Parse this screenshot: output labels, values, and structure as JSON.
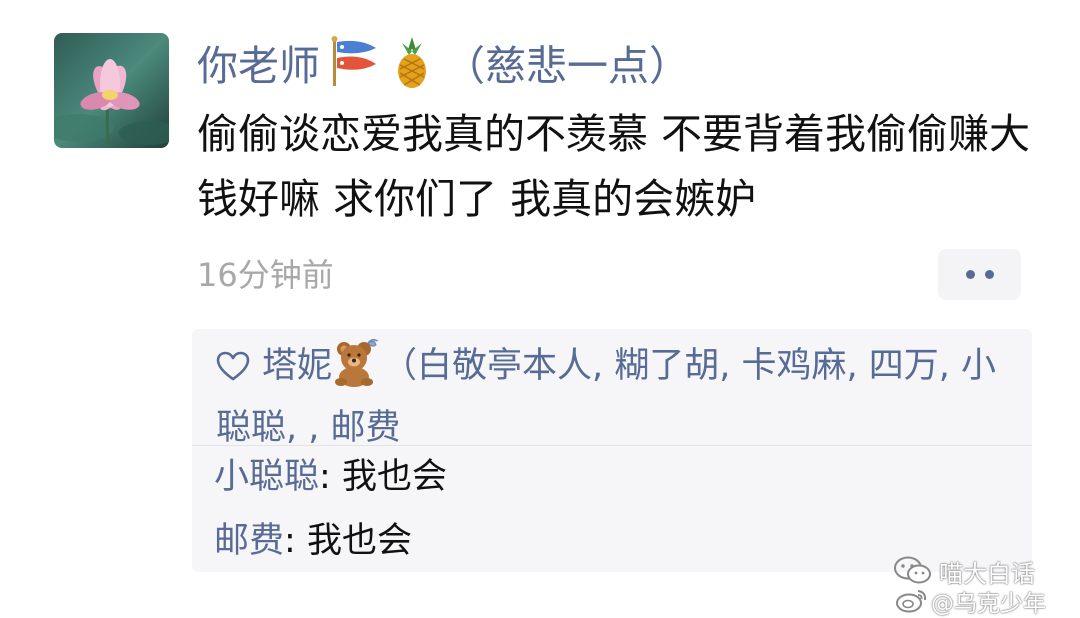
{
  "post": {
    "username": "你老师",
    "username_suffix": "（慈悲一点）",
    "name_emoji_icons": [
      "carp-streamer-icon",
      "pineapple-icon"
    ],
    "text": "偷偷谈恋爱我真的不羡慕 不要背着我偷偷赚大钱好嘛 求你们了 我真的会嫉妒",
    "timestamp": "16分钟前"
  },
  "likes": {
    "heart_icon": "heart-outline-icon",
    "first_liker": "塔妮",
    "first_liker_emoji": "teddy-bear-icon",
    "rest": "（白敬亭本人, 糊了胡, 卡鸡麻, 四万, 小聪聪, , 邮费"
  },
  "comments": [
    {
      "author": "小聪聪",
      "separator": ": ",
      "text": "我也会"
    },
    {
      "author": "邮费",
      "separator": ": ",
      "text": "我也会"
    }
  ],
  "watermark": {
    "line1": "喵大白话",
    "line2": "@乌克少年"
  },
  "colors": {
    "link_blue": "#576b95",
    "text": "#111111",
    "timestamp_gray": "#a8a8a8",
    "comment_bg": "#f6f6f8"
  }
}
